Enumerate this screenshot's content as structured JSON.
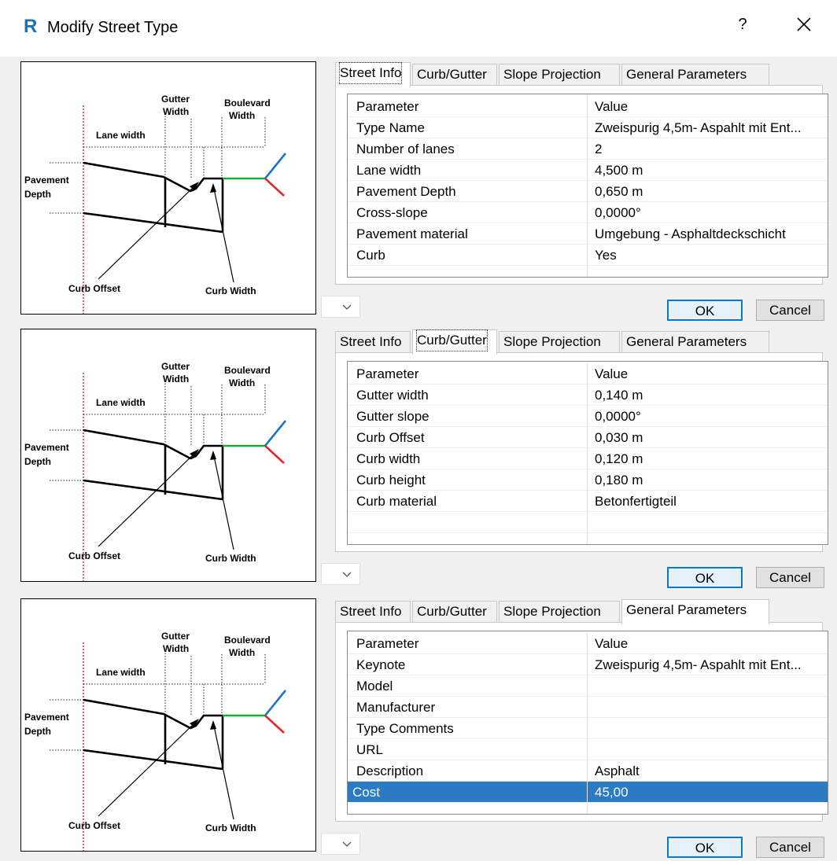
{
  "window": {
    "logo": "R",
    "title": "Modify Street Type",
    "help": "?",
    "close_icon": "close-icon"
  },
  "diagram_labels": {
    "gutter_width": "Gutter Width",
    "boulevard_width": "Boulevard Width",
    "lane_width": "Lane width",
    "pavement_depth": "Pavement Depth",
    "curb_offset": "Curb Offset",
    "curb_width": "Curb Width"
  },
  "tabs": [
    "Street Info",
    "Curb/Gutter",
    "Slope Projection",
    "General Parameters"
  ],
  "buttons": {
    "ok": "OK",
    "cancel": "Cancel"
  },
  "panels": [
    {
      "active_tab": "Street Info",
      "header": {
        "param": "Parameter",
        "value": "Value"
      },
      "rows": [
        {
          "param": "Type Name",
          "value": "Zweispurig 4,5m- Aspahlt mit Ent..."
        },
        {
          "param": "Number of lanes",
          "value": "2"
        },
        {
          "param": "Lane width",
          "value": "4,500 m"
        },
        {
          "param": "Pavement Depth",
          "value": "0,650 m"
        },
        {
          "param": "Cross-slope",
          "value": "0,0000°"
        },
        {
          "param": "Pavement material",
          "value": "Umgebung - Asphaltdeckschicht"
        },
        {
          "param": "Curb",
          "value": "Yes"
        }
      ]
    },
    {
      "active_tab": "Curb/Gutter",
      "header": {
        "param": "Parameter",
        "value": "Value"
      },
      "rows": [
        {
          "param": "Gutter width",
          "value": "0,140 m"
        },
        {
          "param": "Gutter slope",
          "value": "0,0000°"
        },
        {
          "param": "Curb Offset",
          "value": "0,030 m"
        },
        {
          "param": "Curb width",
          "value": "0,120 m"
        },
        {
          "param": "Curb height",
          "value": "0,180 m"
        },
        {
          "param": "Curb material",
          "value": "Betonfertigteil"
        }
      ]
    },
    {
      "active_tab": "General Parameters",
      "header": {
        "param": "Parameter",
        "value": "Value"
      },
      "rows": [
        {
          "param": "Keynote",
          "value": "Zweispurig 4,5m- Aspahlt mit Ent..."
        },
        {
          "param": "Model",
          "value": ""
        },
        {
          "param": "Manufacturer",
          "value": ""
        },
        {
          "param": "Type Comments",
          "value": ""
        },
        {
          "param": "URL",
          "value": ""
        },
        {
          "param": "Description",
          "value": "Asphalt"
        },
        {
          "param": "Cost",
          "value": "45,00",
          "selected": true
        }
      ]
    }
  ],
  "colors": {
    "selection": "#2a7ac4",
    "ok_border": "#0078d7",
    "logo": "#1f6fb5"
  }
}
